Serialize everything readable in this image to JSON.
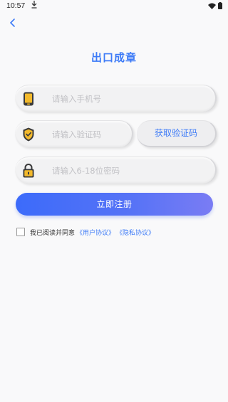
{
  "status_bar": {
    "time": "10:57",
    "icons": [
      "download-icon",
      "wifi-icon",
      "battery-icon"
    ]
  },
  "header": {
    "back_icon": "chevron-left-icon",
    "title": "出口成章"
  },
  "form": {
    "phone": {
      "placeholder": "请输入手机号",
      "value": "",
      "icon": "phone-icon"
    },
    "code": {
      "placeholder": "请输入验证码",
      "value": "",
      "icon": "shield-icon"
    },
    "get_code_label": "获取验证码",
    "password": {
      "placeholder": "请输入6-18位密码",
      "value": "",
      "icon": "lock-icon"
    },
    "submit_label": "立即注册"
  },
  "agreement": {
    "checked": false,
    "text": "我已阅读并同意",
    "user_link": "《用户协议》",
    "privacy_link": "《隐私协议》"
  },
  "colors": {
    "accent": "#3d7bf7",
    "icon_yellow": "#f3b92b",
    "icon_dark": "#3a3a3a",
    "background": "#f9f9fa"
  }
}
